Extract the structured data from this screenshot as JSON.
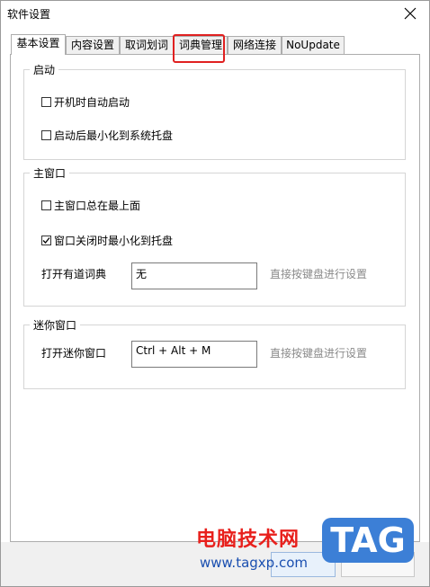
{
  "window": {
    "title": "软件设置"
  },
  "tabs": [
    {
      "label": "基本设置",
      "active": true
    },
    {
      "label": "内容设置",
      "active": false
    },
    {
      "label": "取词划词",
      "active": false
    },
    {
      "label": "词典管理",
      "active": false,
      "highlighted": true
    },
    {
      "label": "网络连接",
      "active": false
    },
    {
      "label": "NoUpdate",
      "active": false
    }
  ],
  "groups": {
    "startup": {
      "title": "启动",
      "options": [
        {
          "label": "开机时自动启动",
          "checked": false
        },
        {
          "label": "启动后最小化到系统托盘",
          "checked": false
        }
      ]
    },
    "main_window": {
      "title": "主窗口",
      "options": [
        {
          "label": "主窗口总在最上面",
          "checked": false
        },
        {
          "label": "窗口关闭时最小化到托盘",
          "checked": true
        }
      ],
      "hotkey_label": "打开有道词典",
      "hotkey_value": "无",
      "hotkey_hint": "直接按键盘进行设置"
    },
    "mini_window": {
      "title": "迷你窗口",
      "hotkey_label": "打开迷你窗口",
      "hotkey_value": "Ctrl + Alt + M",
      "hotkey_hint": "直接按键盘进行设置"
    }
  },
  "watermark": {
    "site_name": "电脑技术网",
    "url": "www.tagxp.com",
    "logo": "TAG"
  },
  "colors": {
    "highlight": "#e02020",
    "hint": "#8a8a8a",
    "watermark_red": "#e8201c",
    "watermark_blue": "#3c7fd6"
  }
}
